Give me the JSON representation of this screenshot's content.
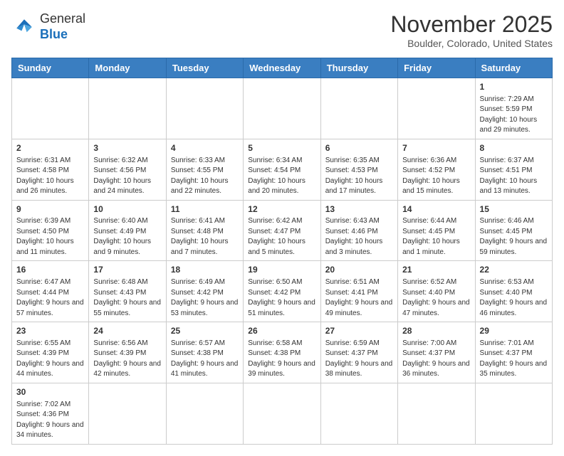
{
  "logo": {
    "line1": "General",
    "line2": "Blue"
  },
  "title": "November 2025",
  "location": "Boulder, Colorado, United States",
  "days_header": [
    "Sunday",
    "Monday",
    "Tuesday",
    "Wednesday",
    "Thursday",
    "Friday",
    "Saturday"
  ],
  "weeks": [
    [
      {
        "day": "",
        "info": ""
      },
      {
        "day": "",
        "info": ""
      },
      {
        "day": "",
        "info": ""
      },
      {
        "day": "",
        "info": ""
      },
      {
        "day": "",
        "info": ""
      },
      {
        "day": "",
        "info": ""
      },
      {
        "day": "1",
        "info": "Sunrise: 7:29 AM\nSunset: 5:59 PM\nDaylight: 10 hours and 29 minutes."
      }
    ],
    [
      {
        "day": "2",
        "info": "Sunrise: 6:31 AM\nSunset: 4:58 PM\nDaylight: 10 hours and 26 minutes."
      },
      {
        "day": "3",
        "info": "Sunrise: 6:32 AM\nSunset: 4:56 PM\nDaylight: 10 hours and 24 minutes."
      },
      {
        "day": "4",
        "info": "Sunrise: 6:33 AM\nSunset: 4:55 PM\nDaylight: 10 hours and 22 minutes."
      },
      {
        "day": "5",
        "info": "Sunrise: 6:34 AM\nSunset: 4:54 PM\nDaylight: 10 hours and 20 minutes."
      },
      {
        "day": "6",
        "info": "Sunrise: 6:35 AM\nSunset: 4:53 PM\nDaylight: 10 hours and 17 minutes."
      },
      {
        "day": "7",
        "info": "Sunrise: 6:36 AM\nSunset: 4:52 PM\nDaylight: 10 hours and 15 minutes."
      },
      {
        "day": "8",
        "info": "Sunrise: 6:37 AM\nSunset: 4:51 PM\nDaylight: 10 hours and 13 minutes."
      }
    ],
    [
      {
        "day": "9",
        "info": "Sunrise: 6:39 AM\nSunset: 4:50 PM\nDaylight: 10 hours and 11 minutes."
      },
      {
        "day": "10",
        "info": "Sunrise: 6:40 AM\nSunset: 4:49 PM\nDaylight: 10 hours and 9 minutes."
      },
      {
        "day": "11",
        "info": "Sunrise: 6:41 AM\nSunset: 4:48 PM\nDaylight: 10 hours and 7 minutes."
      },
      {
        "day": "12",
        "info": "Sunrise: 6:42 AM\nSunset: 4:47 PM\nDaylight: 10 hours and 5 minutes."
      },
      {
        "day": "13",
        "info": "Sunrise: 6:43 AM\nSunset: 4:46 PM\nDaylight: 10 hours and 3 minutes."
      },
      {
        "day": "14",
        "info": "Sunrise: 6:44 AM\nSunset: 4:45 PM\nDaylight: 10 hours and 1 minute."
      },
      {
        "day": "15",
        "info": "Sunrise: 6:46 AM\nSunset: 4:45 PM\nDaylight: 9 hours and 59 minutes."
      }
    ],
    [
      {
        "day": "16",
        "info": "Sunrise: 6:47 AM\nSunset: 4:44 PM\nDaylight: 9 hours and 57 minutes."
      },
      {
        "day": "17",
        "info": "Sunrise: 6:48 AM\nSunset: 4:43 PM\nDaylight: 9 hours and 55 minutes."
      },
      {
        "day": "18",
        "info": "Sunrise: 6:49 AM\nSunset: 4:42 PM\nDaylight: 9 hours and 53 minutes."
      },
      {
        "day": "19",
        "info": "Sunrise: 6:50 AM\nSunset: 4:42 PM\nDaylight: 9 hours and 51 minutes."
      },
      {
        "day": "20",
        "info": "Sunrise: 6:51 AM\nSunset: 4:41 PM\nDaylight: 9 hours and 49 minutes."
      },
      {
        "day": "21",
        "info": "Sunrise: 6:52 AM\nSunset: 4:40 PM\nDaylight: 9 hours and 47 minutes."
      },
      {
        "day": "22",
        "info": "Sunrise: 6:53 AM\nSunset: 4:40 PM\nDaylight: 9 hours and 46 minutes."
      }
    ],
    [
      {
        "day": "23",
        "info": "Sunrise: 6:55 AM\nSunset: 4:39 PM\nDaylight: 9 hours and 44 minutes."
      },
      {
        "day": "24",
        "info": "Sunrise: 6:56 AM\nSunset: 4:39 PM\nDaylight: 9 hours and 42 minutes."
      },
      {
        "day": "25",
        "info": "Sunrise: 6:57 AM\nSunset: 4:38 PM\nDaylight: 9 hours and 41 minutes."
      },
      {
        "day": "26",
        "info": "Sunrise: 6:58 AM\nSunset: 4:38 PM\nDaylight: 9 hours and 39 minutes."
      },
      {
        "day": "27",
        "info": "Sunrise: 6:59 AM\nSunset: 4:37 PM\nDaylight: 9 hours and 38 minutes."
      },
      {
        "day": "28",
        "info": "Sunrise: 7:00 AM\nSunset: 4:37 PM\nDaylight: 9 hours and 36 minutes."
      },
      {
        "day": "29",
        "info": "Sunrise: 7:01 AM\nSunset: 4:37 PM\nDaylight: 9 hours and 35 minutes."
      }
    ],
    [
      {
        "day": "30",
        "info": "Sunrise: 7:02 AM\nSunset: 4:36 PM\nDaylight: 9 hours and 34 minutes."
      },
      {
        "day": "",
        "info": ""
      },
      {
        "day": "",
        "info": ""
      },
      {
        "day": "",
        "info": ""
      },
      {
        "day": "",
        "info": ""
      },
      {
        "day": "",
        "info": ""
      },
      {
        "day": "",
        "info": ""
      }
    ]
  ]
}
